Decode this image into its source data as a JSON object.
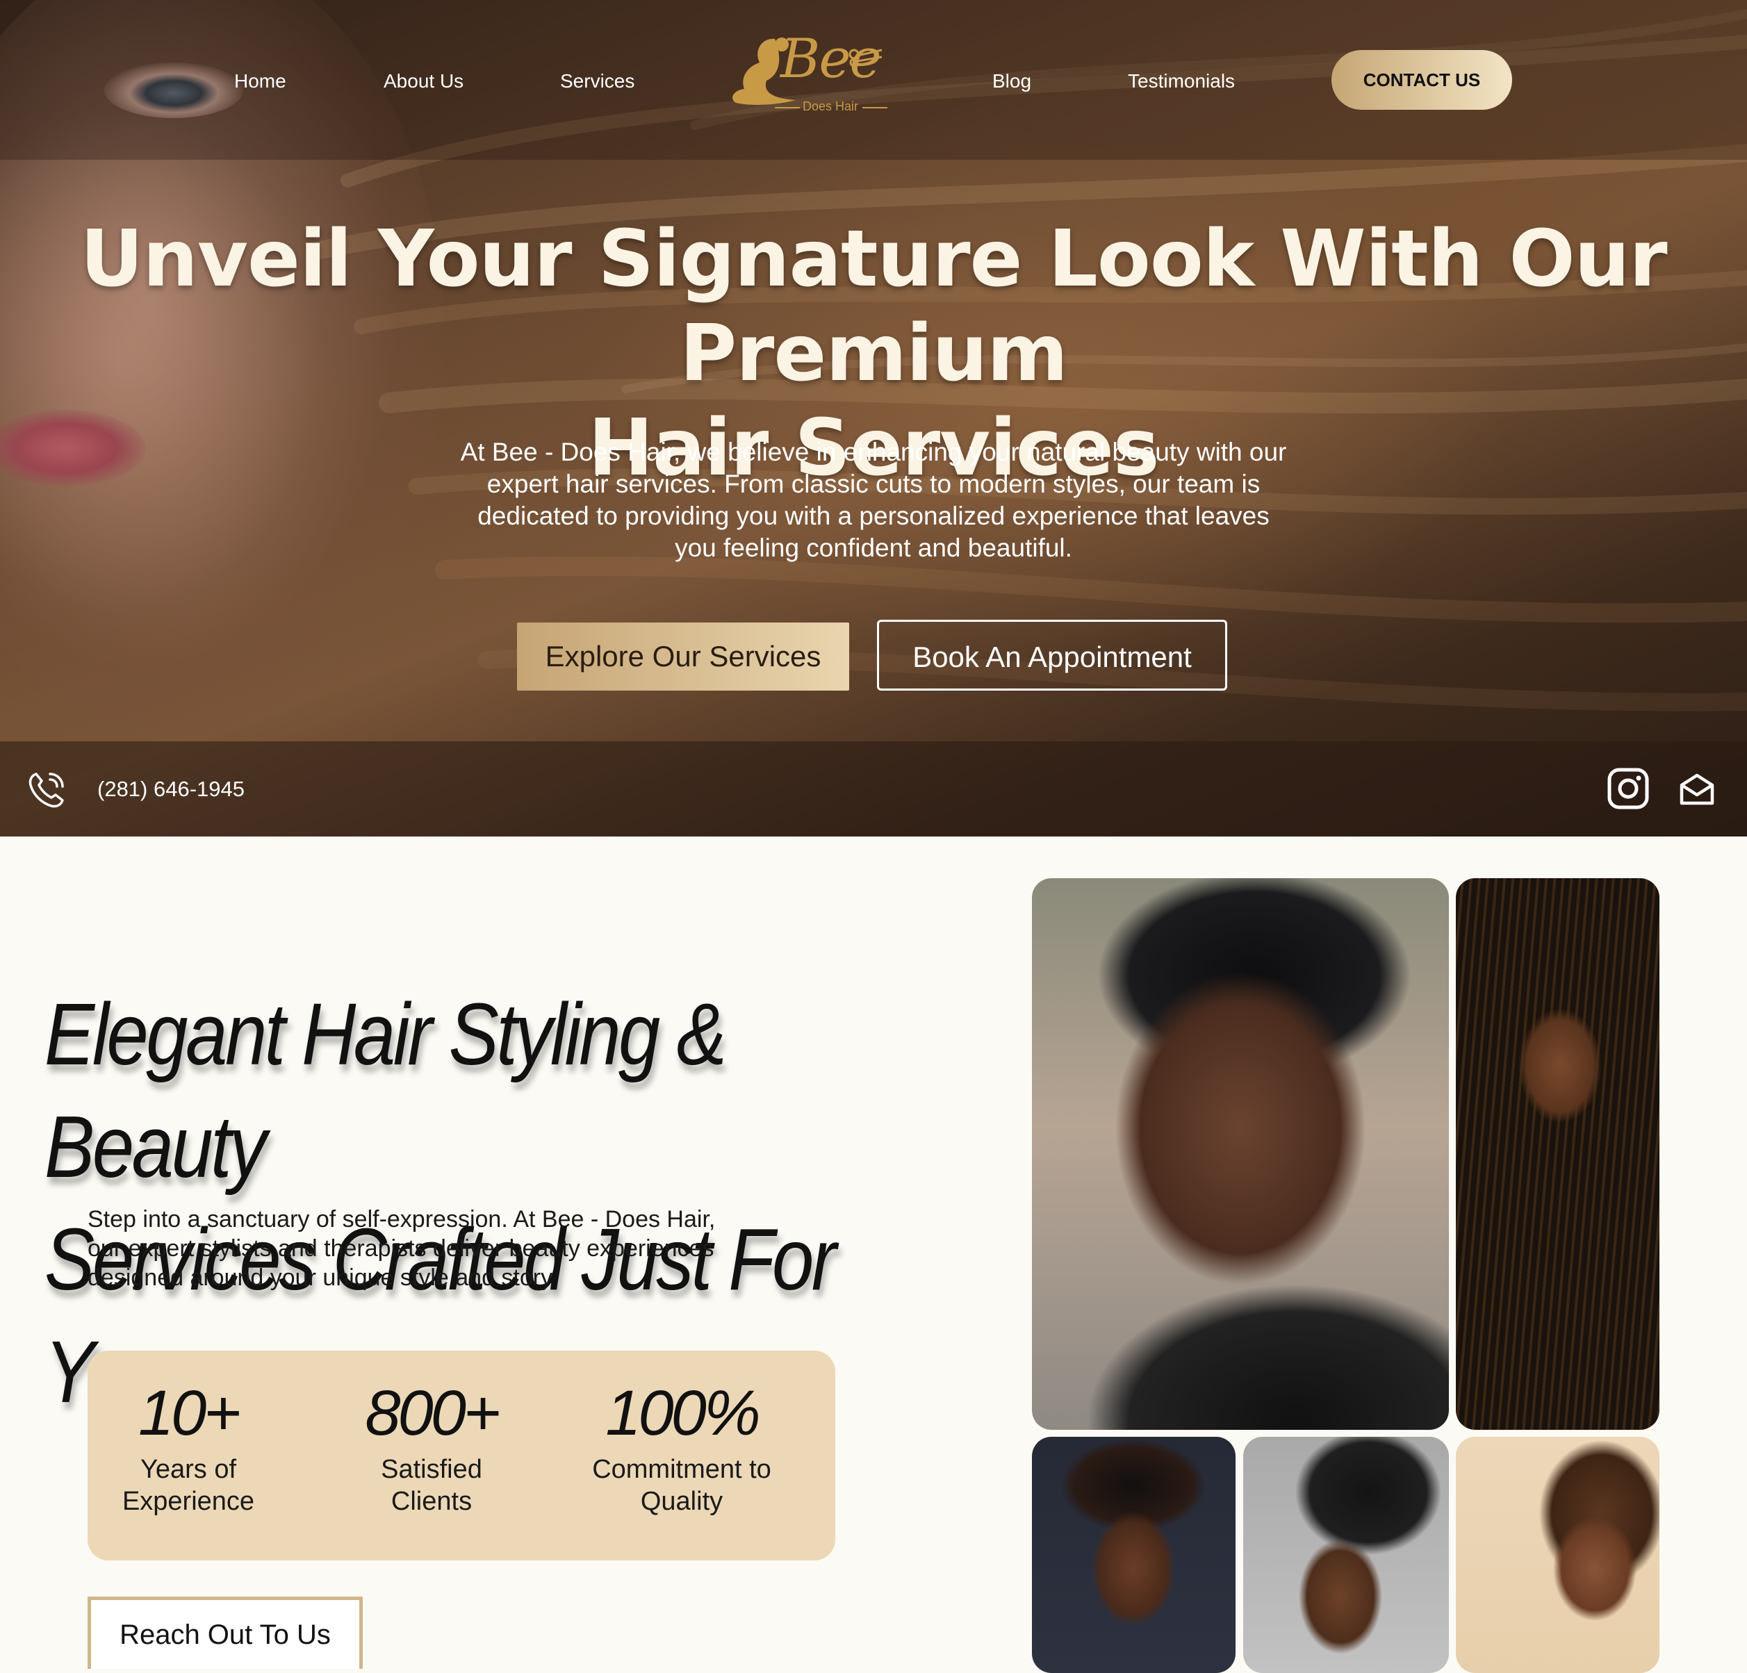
{
  "nav": {
    "items": [
      {
        "label": "Home"
      },
      {
        "label": "About Us"
      },
      {
        "label": "Services"
      },
      {
        "label": "Blog"
      },
      {
        "label": "Testimonials"
      }
    ],
    "logo": {
      "text": "Bee",
      "subtext": "Does Hair"
    },
    "contact_button": "CONTACT US"
  },
  "hero": {
    "title_line1": "Unveil Your Signature Look With Our Premium",
    "title_line2": "Hair Services",
    "description": "At Bee - Does Hair, we believe in enhancing your natural beauty with our expert hair services. From classic cuts to modern styles, our team is dedicated to providing you with a personalized experience that leaves you feeling confident and beautiful.",
    "explore_button": "Explore Our Services",
    "book_button": "Book An Appointment"
  },
  "contact_strip": {
    "phone": "(281) 646-1945",
    "icons": [
      "phone-icon",
      "instagram-icon",
      "mail-icon"
    ]
  },
  "about": {
    "title_line1": "Elegant Hair Styling & Beauty",
    "title_line2": "Services Crafted Just For You",
    "description": "Step into a sanctuary of self-expression. At Bee - Does Hair, our expert stylists and therapists deliver beauty experiences designed around your unique style and story",
    "stats": [
      {
        "value": "10+",
        "label_line1": "Years of",
        "label_line2": "Experience"
      },
      {
        "value": "800+",
        "label_line1": "Satisfied",
        "label_line2": "Clients"
      },
      {
        "value": "100%",
        "label_line1": "Commitment to",
        "label_line2": "Quality"
      }
    ],
    "reach_button": "Reach Out To Us"
  },
  "colors": {
    "accent_gold": "#c89a46",
    "button_gradient_start": "#c6a474",
    "button_gradient_end": "#e9d5ae",
    "stats_background": "#ecd8b6",
    "page_background": "#fcfaf4"
  }
}
